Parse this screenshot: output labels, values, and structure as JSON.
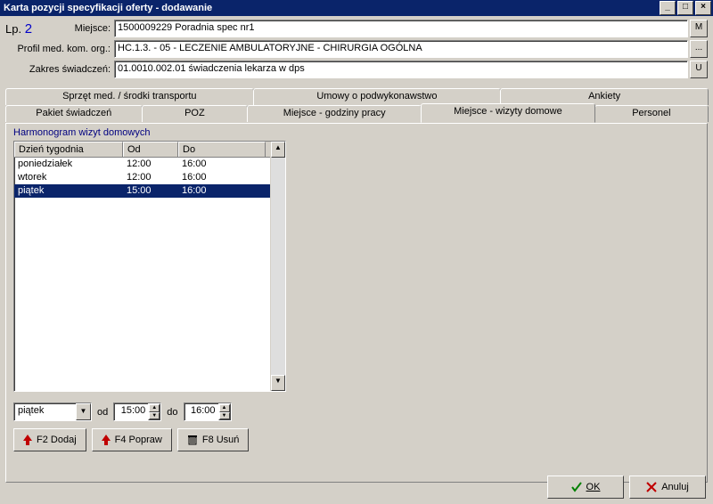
{
  "window": {
    "title": "Karta pozycji specyfikacji oferty - dodawanie"
  },
  "header": {
    "lp_label": "Lp.",
    "lp_value": "2",
    "miejsce_label": "Miejsce:",
    "miejsce_value": "1500009229 Poradnia spec nr1",
    "miejsce_btn": "M",
    "profil_label": "Profil med. kom. org.:",
    "profil_value": "HC.1.3. - 05 - LECZENIE AMBULATORYJNE - CHIRURGIA OGÓLNA",
    "profil_btn": "...",
    "zakres_label": "Zakres świadczeń:",
    "zakres_value": "01.0010.002.01 świadczenia lekarza w dps",
    "zakres_btn": "U"
  },
  "tabs": {
    "row1": [
      "Sprzęt med. / środki transportu",
      "Umowy o podwykonawstwo",
      "Ankiety"
    ],
    "row2": [
      "Pakiet świadczeń",
      "POZ",
      "Miejsce - godziny pracy",
      "Miejsce - wizyty domowe",
      "Personel"
    ],
    "active": "Miejsce - wizyty domowe"
  },
  "schedule": {
    "section_label": "Harmonogram wizyt domowych",
    "headers": {
      "day": "Dzień tygodnia",
      "from": "Od",
      "to": "Do"
    },
    "rows": [
      {
        "day": "poniedziałek",
        "from": "12:00",
        "to": "16:00",
        "selected": false
      },
      {
        "day": "wtorek",
        "from": "12:00",
        "to": "16:00",
        "selected": false
      },
      {
        "day": "piątek",
        "from": "15:00",
        "to": "16:00",
        "selected": true
      }
    ],
    "editor": {
      "day": "piątek",
      "from_label": "od",
      "from_value": "15:00",
      "to_label": "do",
      "to_value": "16:00"
    },
    "buttons": {
      "add": "F2 Dodaj",
      "edit": "F4 Popraw",
      "del": "F8 Usuń"
    }
  },
  "dialog": {
    "ok": "OK",
    "cancel": "Anuluj"
  }
}
